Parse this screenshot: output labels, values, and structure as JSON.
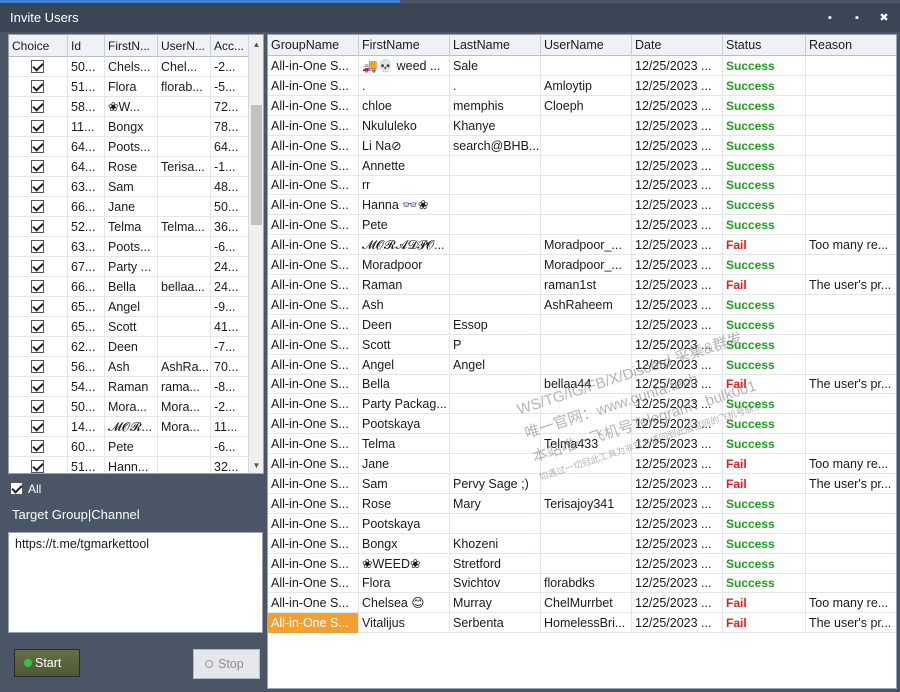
{
  "window": {
    "title": "Invite Users",
    "minimize": "▪",
    "maximize": "▪",
    "close": "✖"
  },
  "left": {
    "columns": [
      "Choice",
      "Id",
      "FirstN...",
      "UserN...",
      "Acc..."
    ],
    "rows": [
      {
        "id": "50...",
        "first": "Chels...",
        "user": "Chel...",
        "acc": "-2..."
      },
      {
        "id": "51...",
        "first": "Flora",
        "user": "florab...",
        "acc": "-5..."
      },
      {
        "id": "58...",
        "first": "❀W...",
        "user": "",
        "acc": "72..."
      },
      {
        "id": "11...",
        "first": "Bongx",
        "user": "",
        "acc": "78..."
      },
      {
        "id": "64...",
        "first": "Poots...",
        "user": "",
        "acc": "64..."
      },
      {
        "id": "64...",
        "first": "Rose",
        "user": "Terisa...",
        "acc": "-1..."
      },
      {
        "id": "63...",
        "first": "Sam",
        "user": "",
        "acc": "48..."
      },
      {
        "id": "66...",
        "first": "Jane",
        "user": "",
        "acc": "50..."
      },
      {
        "id": "52...",
        "first": "Telma",
        "user": "Telma...",
        "acc": "36..."
      },
      {
        "id": "63...",
        "first": "Poots...",
        "user": "",
        "acc": "-6..."
      },
      {
        "id": "67...",
        "first": "Party ...",
        "user": "",
        "acc": "24..."
      },
      {
        "id": "66...",
        "first": "Bella",
        "user": "bellaa...",
        "acc": "24..."
      },
      {
        "id": "65...",
        "first": "Angel",
        "user": "",
        "acc": "-9..."
      },
      {
        "id": "65...",
        "first": "Scott",
        "user": "",
        "acc": "41..."
      },
      {
        "id": "62...",
        "first": "Deen",
        "user": "",
        "acc": "-7..."
      },
      {
        "id": "56...",
        "first": "Ash",
        "user": "AshRa...",
        "acc": "70..."
      },
      {
        "id": "54...",
        "first": "Raman",
        "user": "rama...",
        "acc": "-8..."
      },
      {
        "id": "50...",
        "first": "Mora...",
        "user": "Mora...",
        "acc": "-2..."
      },
      {
        "id": "14...",
        "first": "𝓜𝓞𝓡...",
        "user": "Mora...",
        "acc": "11..."
      },
      {
        "id": "60...",
        "first": "Pete",
        "user": "",
        "acc": "-6..."
      },
      {
        "id": "51...",
        "first": "Hann...",
        "user": "",
        "acc": "32..."
      }
    ],
    "all_label": "All",
    "target_label": "Target  Group|Channel",
    "target_value": "https://t.me/tgmarkettool",
    "start_label": "Start",
    "stop_label": "Stop"
  },
  "right": {
    "columns": [
      "GroupName",
      "FirstName",
      "LastName",
      "UserName",
      "Date",
      "Status",
      "Reason"
    ],
    "rows": [
      {
        "group": "All-in-One S...",
        "first": "🚚💀 weed ...",
        "last": "Sale",
        "user": "",
        "date": "12/25/2023 ...",
        "status": "Success",
        "reason": ""
      },
      {
        "group": "All-in-One S...",
        "first": ".",
        "last": ".",
        "user": "Amloytip",
        "date": "12/25/2023 ...",
        "status": "Success",
        "reason": ""
      },
      {
        "group": "All-in-One S...",
        "first": "chloe",
        "last": "memphis",
        "user": "Cloeph",
        "date": "12/25/2023 ...",
        "status": "Success",
        "reason": ""
      },
      {
        "group": "All-in-One S...",
        "first": "Nkululeko",
        "last": "Khanye",
        "user": "",
        "date": "12/25/2023 ...",
        "status": "Success",
        "reason": ""
      },
      {
        "group": "All-in-One S...",
        "first": "Li Na⊘",
        "last": "search@BHB...",
        "user": "",
        "date": "12/25/2023 ...",
        "status": "Success",
        "reason": ""
      },
      {
        "group": "All-in-One S...",
        "first": "Annette",
        "last": "",
        "user": "",
        "date": "12/25/2023 ...",
        "status": "Success",
        "reason": ""
      },
      {
        "group": "All-in-One S...",
        "first": "rr",
        "last": "",
        "user": "",
        "date": "12/25/2023 ...",
        "status": "Success",
        "reason": ""
      },
      {
        "group": "All-in-One S...",
        "first": "Hanna 👓❀",
        "last": "",
        "user": "",
        "date": "12/25/2023 ...",
        "status": "Success",
        "reason": ""
      },
      {
        "group": "All-in-One S...",
        "first": "Pete",
        "last": "",
        "user": "",
        "date": "12/25/2023 ...",
        "status": "Success",
        "reason": ""
      },
      {
        "group": "All-in-One S...",
        "first": "𝓜𝓞𝓡𝓐𝓓𝓟𝓞...",
        "last": "",
        "user": "Moradpoor_...",
        "date": "12/25/2023 ...",
        "status": "Fail",
        "reason": "Too many re..."
      },
      {
        "group": "All-in-One S...",
        "first": "Moradpoor",
        "last": "",
        "user": "Moradpoor_...",
        "date": "12/25/2023 ...",
        "status": "Success",
        "reason": ""
      },
      {
        "group": "All-in-One S...",
        "first": "Raman",
        "last": "",
        "user": "raman1st",
        "date": "12/25/2023 ...",
        "status": "Fail",
        "reason": "The user's pr..."
      },
      {
        "group": "All-in-One S...",
        "first": "Ash",
        "last": "",
        "user": "AshRaheem",
        "date": "12/25/2023 ...",
        "status": "Success",
        "reason": ""
      },
      {
        "group": "All-in-One S...",
        "first": "Deen",
        "last": "Essop",
        "user": "",
        "date": "12/25/2023 ...",
        "status": "Success",
        "reason": ""
      },
      {
        "group": "All-in-One S...",
        "first": "Scott",
        "last": "P",
        "user": "",
        "date": "12/25/2023 ...",
        "status": "Success",
        "reason": ""
      },
      {
        "group": "All-in-One S...",
        "first": "Angel",
        "last": "Angel",
        "user": "",
        "date": "12/25/2023 ...",
        "status": "Success",
        "reason": ""
      },
      {
        "group": "All-in-One S...",
        "first": "Bella",
        "last": "",
        "user": "bellaa44",
        "date": "12/25/2023 ...",
        "status": "Fail",
        "reason": "The user's pr..."
      },
      {
        "group": "All-in-One S...",
        "first": "Party Packag...",
        "last": "",
        "user": "",
        "date": "12/25/2023 ...",
        "status": "Success",
        "reason": ""
      },
      {
        "group": "All-in-One S...",
        "first": "Pootskaya",
        "last": "",
        "user": "",
        "date": "12/25/2023 ...",
        "status": "Success",
        "reason": ""
      },
      {
        "group": "All-in-One S...",
        "first": "Telma",
        "last": "",
        "user": "Telma433",
        "date": "12/25/2023 ...",
        "status": "Success",
        "reason": ""
      },
      {
        "group": "All-in-One S...",
        "first": "Jane",
        "last": "",
        "user": "",
        "date": "12/25/2023 ...",
        "status": "Fail",
        "reason": "Too many re..."
      },
      {
        "group": "All-in-One S...",
        "first": "Sam",
        "last": "Pervy Sage ;)",
        "user": "",
        "date": "12/25/2023 ...",
        "status": "Fail",
        "reason": "The user's pr..."
      },
      {
        "group": "All-in-One S...",
        "first": "Rose",
        "last": "Mary",
        "user": "Terisajoy341",
        "date": "12/25/2023 ...",
        "status": "Success",
        "reason": ""
      },
      {
        "group": "All-in-One S...",
        "first": "Pootskaya",
        "last": "",
        "user": "",
        "date": "12/25/2023 ...",
        "status": "Success",
        "reason": ""
      },
      {
        "group": "All-in-One S...",
        "first": "Bongx",
        "last": "Khozeni",
        "user": "",
        "date": "12/25/2023 ...",
        "status": "Success",
        "reason": ""
      },
      {
        "group": "All-in-One S...",
        "first": "❀WEED❀",
        "last": "Stretford",
        "user": "",
        "date": "12/25/2023 ...",
        "status": "Success",
        "reason": ""
      },
      {
        "group": "All-in-One S...",
        "first": "Flora",
        "last": "Svichtov",
        "user": "florabdks",
        "date": "12/25/2023 ...",
        "status": "Success",
        "reason": ""
      },
      {
        "group": "All-in-One S...",
        "first": "Chelsea 😊",
        "last": "Murray",
        "user": "ChelMurrbet",
        "date": "12/25/2023 ...",
        "status": "Fail",
        "reason": "Too many re..."
      },
      {
        "group": "All-in-One S...",
        "first": "Vitalijus",
        "last": "Serbenta",
        "user": "HomelessBri...",
        "date": "12/25/2023 ...",
        "status": "Fail",
        "reason": "The user's pr..."
      }
    ]
  },
  "watermark": {
    "line1": "WS/TG/IG/FB/X/Discord 采集&群发",
    "line2": "唯一官网：www.gunfa.tech",
    "line3": "本站唯一飞机号Telegram：bulk001",
    "line4": "如遇过一切冠此工具为非官方请回到此版官网的飞机号联系"
  },
  "colors": {
    "success": "#1e9e1e",
    "fail": "#e02020",
    "selected": "#f2a033"
  }
}
